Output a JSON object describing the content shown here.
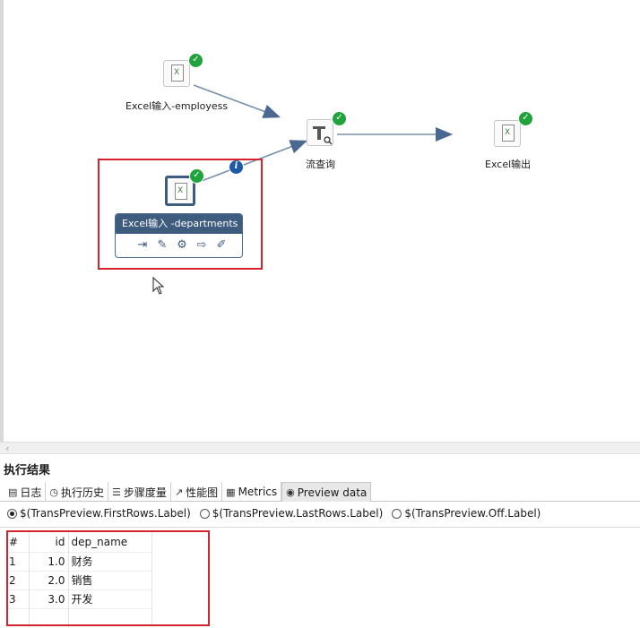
{
  "canvas": {
    "steps": [
      {
        "id": "employees",
        "label": "Excel输入-employess"
      },
      {
        "id": "lookup",
        "label": "流查询"
      },
      {
        "id": "output",
        "label": "Excel输出"
      },
      {
        "id": "departments",
        "label": "Excel输入 -departments"
      }
    ],
    "popup_title": "Excel输入 -departments",
    "popup_icons": [
      "input-icon",
      "edit-icon",
      "settings-icon",
      "output-icon",
      "pen-icon"
    ],
    "status_color": "#20a33a",
    "highlight_color": "#d4232f"
  },
  "panel": {
    "title": "执行结果",
    "tabs": [
      {
        "label": "日志",
        "icon": "log-icon"
      },
      {
        "label": "执行历史",
        "icon": "history-icon"
      },
      {
        "label": "步骤度量",
        "icon": "metrics-list-icon"
      },
      {
        "label": "性能图",
        "icon": "chart-icon"
      },
      {
        "label": "Metrics",
        "icon": "metrics-icon"
      },
      {
        "label": "Preview data",
        "icon": "eye-icon",
        "active": true
      }
    ],
    "radios": [
      {
        "label": "$(TransPreview.FirstRows.Label)",
        "selected": true
      },
      {
        "label": "$(TransPreview.LastRows.Label)",
        "selected": false
      },
      {
        "label": "$(TransPreview.Off.Label)",
        "selected": false
      }
    ],
    "table": {
      "headers": [
        "#",
        "id",
        "dep_name"
      ],
      "rows": [
        [
          "1",
          "1.0",
          "财务"
        ],
        [
          "2",
          "2.0",
          "销售"
        ],
        [
          "3",
          "3.0",
          "开发"
        ]
      ]
    }
  }
}
